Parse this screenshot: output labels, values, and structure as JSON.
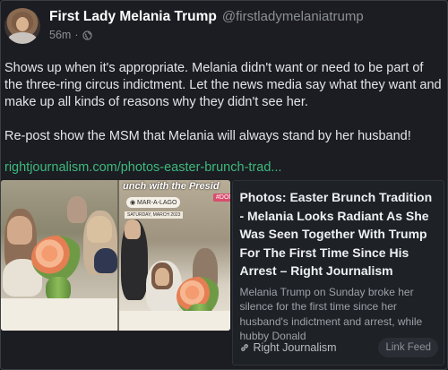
{
  "post": {
    "display_name": "First Lady Melania Trump",
    "handle": "@firstladymelaniatrump",
    "time": "56m",
    "dot": "·",
    "visibility_icon": "globe-icon",
    "body": [
      "Shows up when it's appropriate. Melania didn't want or need to be part of the three-ring circus indictment. Let the news media say what they want and make up all kinds of reasons why they didn't see her.",
      "Re-post show the MSM that Melania will always stand by her husband!"
    ],
    "link": "rightjournalism.com/photos-easter-brunch-trad..."
  },
  "card": {
    "image_overlay_title": "unch with the Presid",
    "image_sticker": "◉ MAR-A-LAGO",
    "image_hashtag": "#DONA",
    "image_sub_sticker": "SATURDAY, MARCH 2023",
    "title": "Photos: Easter Brunch Tradition - Melania Looks Radiant As She Was Seen Together With Trump For The First Time Since His Arrest – Right Journalism",
    "description": "Melania Trump on Sunday broke her silence for the first time since her husband's indictment and arrest, while hubby Donald",
    "source": "Right Journalism",
    "source_icon": "link-icon",
    "feed_button": "Link Feed"
  },
  "colors": {
    "background": "#1b1d22",
    "link": "#3fb87c",
    "muted": "#8b8f96"
  }
}
